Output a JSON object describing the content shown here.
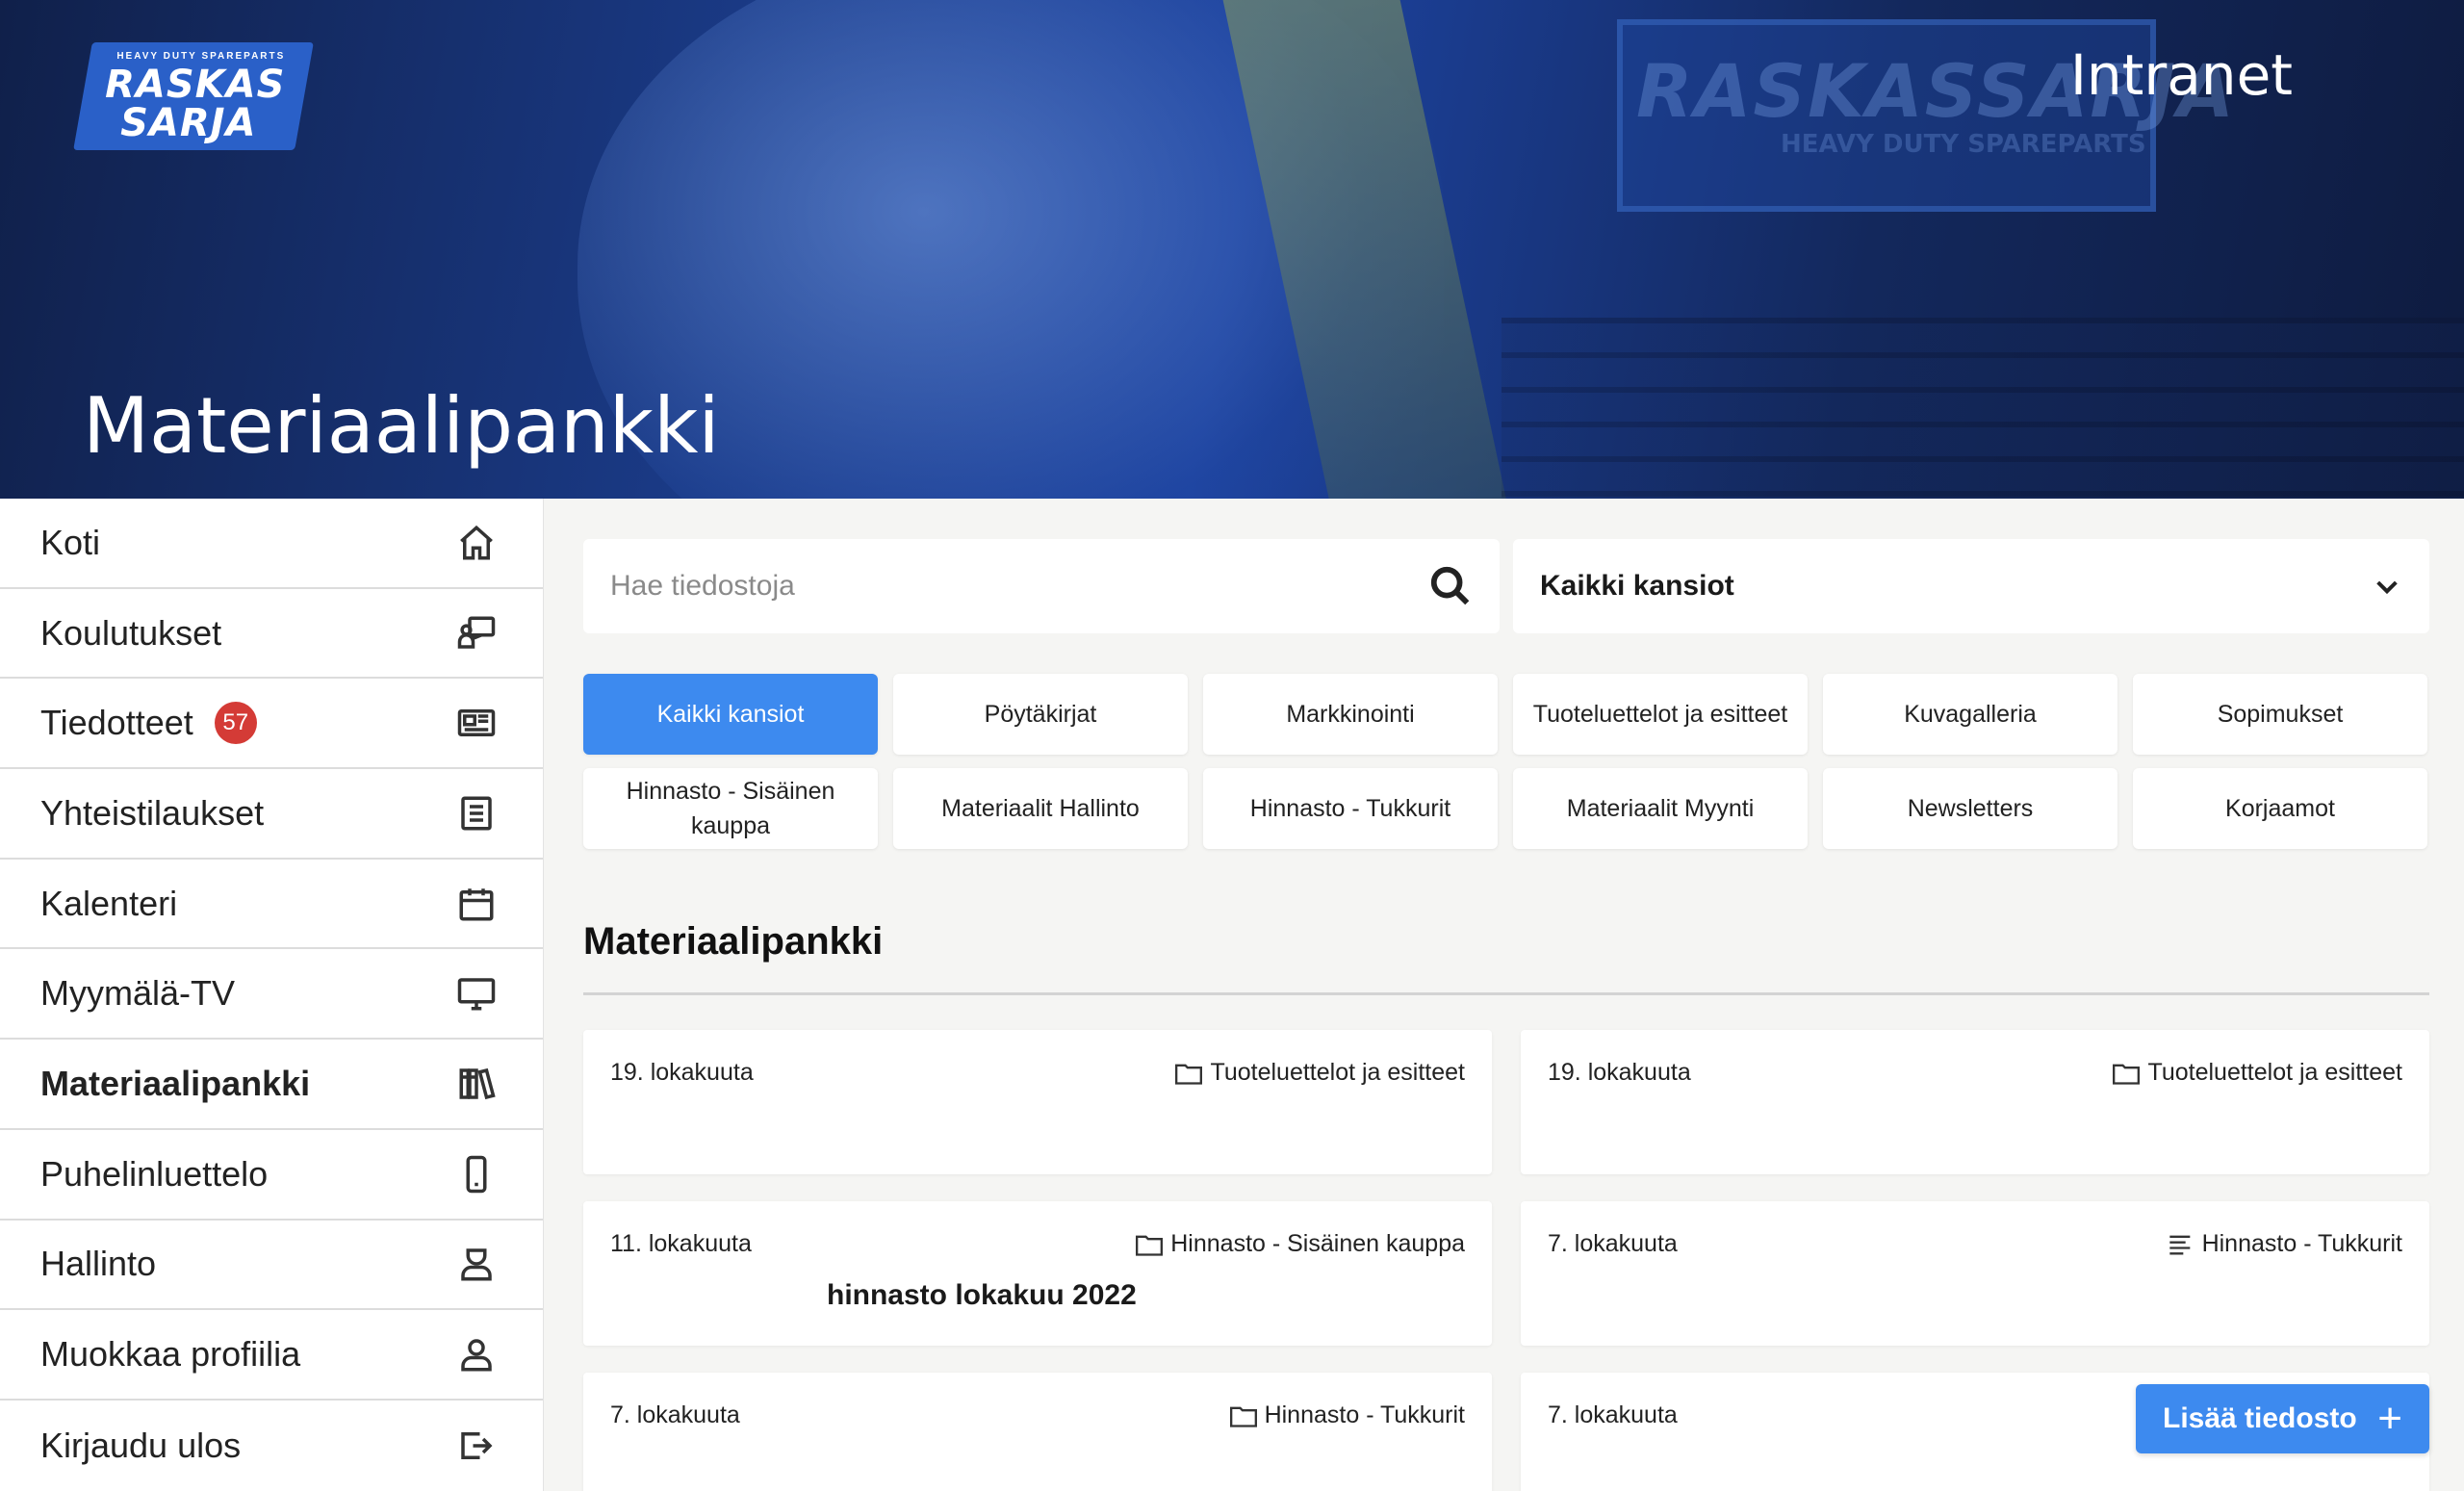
{
  "header": {
    "logo": {
      "tagline": "HEAVY DUTY SPAREPARTS",
      "line1": "RASKAS",
      "line2": "SARJA"
    },
    "app_title": "Intranet",
    "page_title": "Materiaalipankki",
    "bg_sign": "RASKASSARJA",
    "bg_sign_sub": "HEAVY DUTY SPAREPARTS"
  },
  "sidebar": {
    "items": [
      {
        "label": "Koti",
        "icon": "home-icon"
      },
      {
        "label": "Koulutukset",
        "icon": "training-icon"
      },
      {
        "label": "Tiedotteet",
        "icon": "news-icon",
        "badge": "57"
      },
      {
        "label": "Yhteistilaukset",
        "icon": "clipboard-icon"
      },
      {
        "label": "Kalenteri",
        "icon": "calendar-icon"
      },
      {
        "label": "Myymälä-TV",
        "icon": "monitor-icon"
      },
      {
        "label": "Materiaalipankki",
        "icon": "books-icon",
        "active": true
      },
      {
        "label": "Puhelinluettelo",
        "icon": "phone-icon"
      },
      {
        "label": "Hallinto",
        "icon": "admin-icon"
      },
      {
        "label": "Muokkaa profiilia",
        "icon": "user-icon"
      },
      {
        "label": "Kirjaudu ulos",
        "icon": "logout-icon"
      }
    ]
  },
  "search": {
    "placeholder": "Hae tiedostoja",
    "value": ""
  },
  "folder_select": {
    "selected": "Kaikki kansiot"
  },
  "chips": [
    {
      "label": "Kaikki kansiot",
      "active": true
    },
    {
      "label": "Pöytäkirjat"
    },
    {
      "label": "Markkinointi"
    },
    {
      "label": "Tuoteluettelot ja esitteet"
    },
    {
      "label": "Kuvagalleria"
    },
    {
      "label": "Sopimukset"
    },
    {
      "label": "Hinnasto - Sisäinen kauppa"
    },
    {
      "label": "Materiaalit Hallinto"
    },
    {
      "label": "Hinnasto - Tukkurit"
    },
    {
      "label": "Materiaalit Myynti"
    },
    {
      "label": "Newsletters"
    },
    {
      "label": "Korjaamot"
    }
  ],
  "section_title": "Materiaalipankki",
  "cards": [
    {
      "date": "19. lokakuuta",
      "folder": "Tuoteluettelot ja esitteet",
      "folder_icon": "folder-icon",
      "title": ""
    },
    {
      "date": "19. lokakuuta",
      "folder": "Tuoteluettelot ja esitteet",
      "folder_icon": "folder-icon",
      "title": ""
    },
    {
      "date": "11. lokakuuta",
      "folder": "Hinnasto - Sisäinen kauppa",
      "folder_icon": "folder-icon",
      "title": "hinnasto lokakuu 2022"
    },
    {
      "date": "7. lokakuuta",
      "folder": "Hinnasto - Tukkurit",
      "folder_icon": "list-icon",
      "title": ""
    },
    {
      "date": "7. lokakuuta",
      "folder": "Hinnasto - Tukkurit",
      "folder_icon": "folder-icon",
      "title": ""
    },
    {
      "date": "7. lokakuuta",
      "folder": "",
      "folder_icon": "",
      "title": ""
    }
  ],
  "fab": {
    "label": "Lisää tiedosto",
    "icon": "plus-icon"
  },
  "colors": {
    "accent": "#3d8aef",
    "badge": "#d43b36",
    "hero": "#1d43a0"
  }
}
